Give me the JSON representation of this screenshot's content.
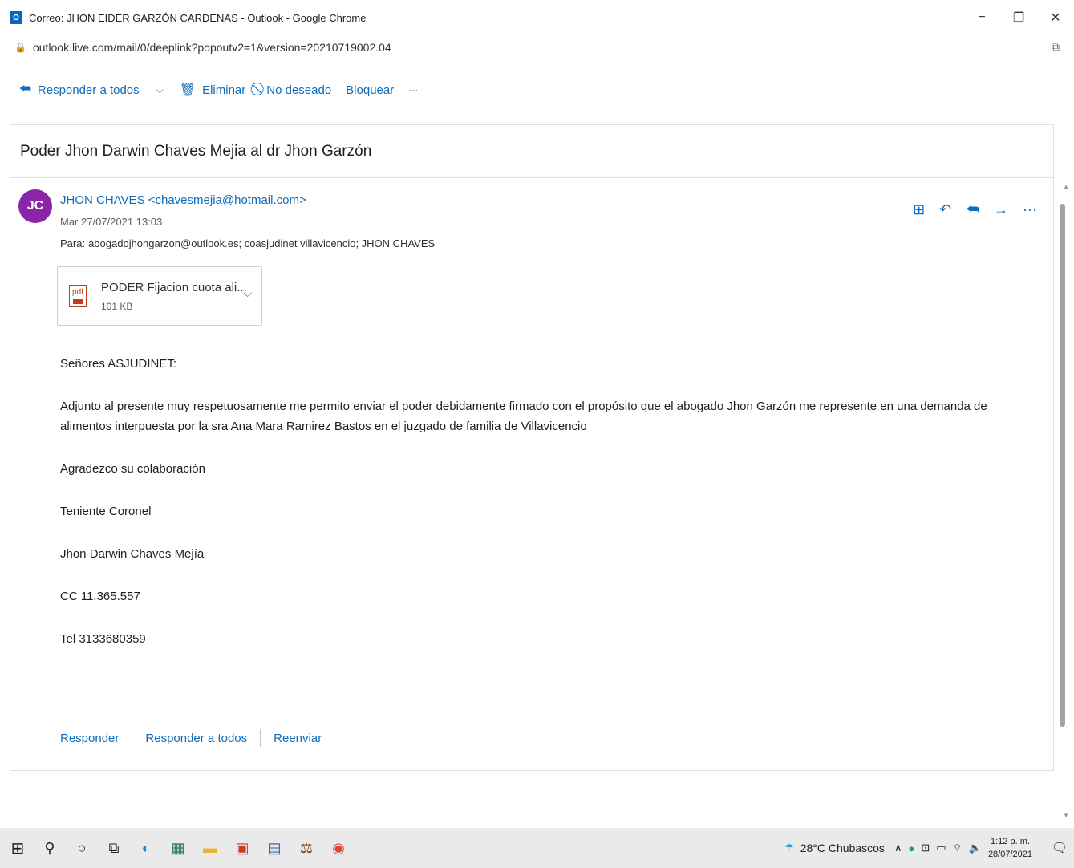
{
  "window": {
    "title": "Correo: JHON EIDER GARZÓN CARDENAS - Outlook - Google Chrome",
    "url": "outlook.live.com/mail/0/deeplink?popoutv2=1&version=20210719002.04"
  },
  "toolbar": {
    "reply_all": "Responder a todos",
    "delete": "Eliminar",
    "junk": "No deseado",
    "block": "Bloquear",
    "more": "···"
  },
  "email": {
    "subject": "Poder Jhon Darwin Chaves Mejia al dr Jhon Garzón",
    "avatar_initials": "JC",
    "sender": "JHON CHAVES <chavesmejia@hotmail.com>",
    "date": "Mar 27/07/2021 13:03",
    "to_label": "Para:",
    "to": "abogadojhongarzon@outlook.es; coasjudinet villavicencio; JHON CHAVES",
    "attachment": {
      "name": "PODER Fijacion cuota ali...",
      "size": "101 KB",
      "type_label": "pdf"
    },
    "body": {
      "greeting": "Señores ASJUDINET:",
      "paragraph": "Adjunto al presente muy respetuosamente me permito enviar el poder debidamente firmado con el propósito que el abogado Jhon Garzón me represente en una demanda de alimentos interpuesta por la sra Ana Mara Ramirez Bastos en el juzgado de familia de Villavicencio",
      "thanks": "Agradezco su colaboración",
      "rank": "Teniente Coronel",
      "name": "Jhon Darwin Chaves Mejía",
      "cc": "CC 11.365.557",
      "tel": "Tel 3133680359"
    },
    "actions": {
      "reply": "Responder",
      "reply_all": "Responder a todos",
      "forward": "Reenviar"
    }
  },
  "taskbar": {
    "weather": "28°C Chubascos",
    "time": "1:12 p. m.",
    "date": "28/07/2021"
  },
  "colors": {
    "accent": "#0f6cbd",
    "avatar": "#8b25a8"
  }
}
